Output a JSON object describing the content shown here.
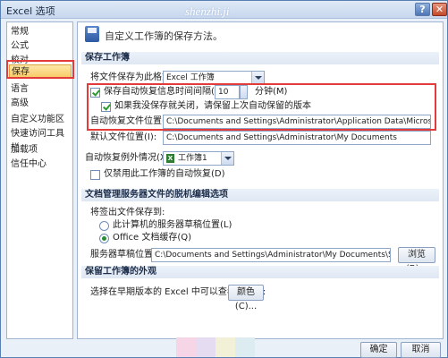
{
  "window": {
    "title": "Excel 选项",
    "watermark": "shenzhi.ji"
  },
  "sidebar": {
    "items": [
      {
        "label": "常规"
      },
      {
        "label": "公式"
      },
      {
        "label": "校对"
      },
      {
        "label": "保存",
        "selected": true
      },
      {
        "label": "语言"
      },
      {
        "label": "高级"
      },
      {
        "label": "自定义功能区"
      },
      {
        "label": "快速访问工具栏"
      },
      {
        "label": "加载项"
      },
      {
        "label": "信任中心"
      }
    ]
  },
  "header": {
    "text": "自定义工作簿的保存方法。",
    "icon": "save-icon"
  },
  "save_workbooks": {
    "section_label": "保存工作簿",
    "format_label": "将文件保存为此格式(F):",
    "format_value": "Excel 工作簿",
    "autorecover_label": "保存自动恢复信息时间间隔(A)",
    "autorecover_checked": true,
    "autorecover_minutes": "10",
    "minutes_unit": "分钟(M)",
    "keep_last_label": "如果我没保存就关闭，请保留上次自动保留的版本",
    "keep_last_checked": true,
    "autorecover_location_label": "自动恢复文件位置(R):",
    "autorecover_location_value": "C:\\Documents and Settings\\Administrator\\Application Data\\Microsoft\\Excel\\",
    "default_location_label": "默认文件位置(I):",
    "default_location_value": "C:\\Documents and Settings\\Administrator\\My Documents"
  },
  "autorecover_exceptions": {
    "label": "自动恢复例外情况(X):",
    "value": "工作簿1",
    "disable_label": "仅禁用此工作簿的自动恢复(D)",
    "disable_checked": false
  },
  "offline_editing": {
    "section_label": "文档管理服务器文件的脱机编辑选项",
    "save_to_label": "将签出文件保存到:",
    "option_server": "此计算机的服务器草稿位置(L)",
    "option_cache": "Office 文档缓存(Q)",
    "selected": "option_cache",
    "drafts_label": "服务器草稿位置(V):",
    "drafts_value": "C:\\Documents and Settings\\Administrator\\My Documents\\SharePoint 草稿\\",
    "browse_label": "浏览(B)..."
  },
  "visual": {
    "section_label": "保留工作簿的外观",
    "colors_label": "选择在早期版本的 Excel 中可以查看的颜色:",
    "colors_button": "颜色(C)..."
  },
  "footer": {
    "ok_label": "确定",
    "cancel_label": "取消"
  },
  "colors": {
    "highlight_border": "#e33a3a",
    "selected_item": "#f8c965",
    "accent": "#5a7fb3"
  }
}
